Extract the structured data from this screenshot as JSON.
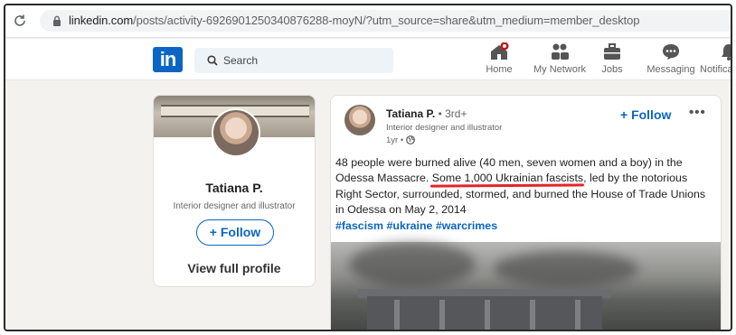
{
  "browser": {
    "url_host": "linkedin.com",
    "url_rest": "/posts/activity-6926901250340876288-moyN/?utm_source=share&utm_medium=member_desktop"
  },
  "nav": {
    "logo": "in",
    "search_placeholder": "Search",
    "items": [
      {
        "label": "Home",
        "icon": "home-icon"
      },
      {
        "label": "My Network",
        "icon": "network-icon"
      },
      {
        "label": "Jobs",
        "icon": "briefcase-icon"
      },
      {
        "label": "Messaging",
        "icon": "messaging-icon"
      },
      {
        "label": "Notificat",
        "icon": "bell-icon"
      }
    ]
  },
  "profile": {
    "name": "Tatiana P.",
    "title": "Interior designer and illustrator",
    "follow_label": "+ Follow",
    "view_label": "View full profile"
  },
  "post": {
    "author_name": "Tatiana P.",
    "author_degree": "• 3rd+",
    "author_title": "Interior designer and illustrator",
    "time": "1yr •",
    "follow_label": "+ Follow",
    "more_label": "•••",
    "text_part1": "48 people were burned alive (40 men, seven women and a boy) in the Odessa Massacre.",
    "text_underlined": " Some 1,000 Ukrainian fascists,",
    "text_part2": " led by the notorious Right Sector, surrounded, stormed, and burned the House of Trade Unions in Odessa on May 2, 2014",
    "hashtags": "#fascism #ukraine #warcrimes"
  },
  "colors": {
    "brand": "#0a66c2",
    "annotation": "#e3242b",
    "background": "#f3f2ef"
  }
}
